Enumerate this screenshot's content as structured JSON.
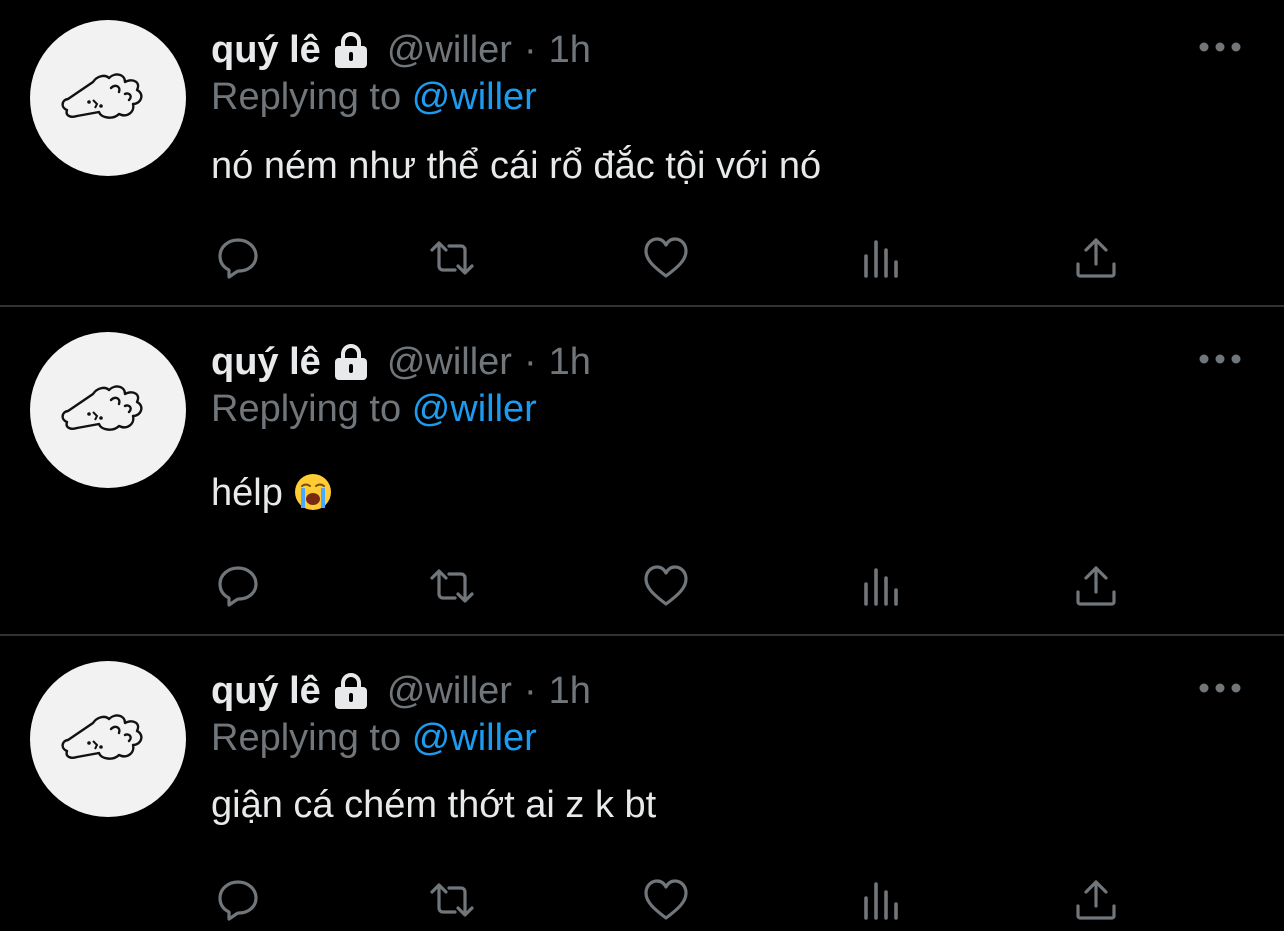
{
  "tweets": [
    {
      "author": {
        "name": "quý lê",
        "handle": "@willer",
        "protected_icon": "lock-icon",
        "avatar_icon": "bear-doodle-avatar"
      },
      "time": "1h",
      "separator": "·",
      "replying_label": "Replying to",
      "replying_to": "@willer",
      "text": "nó ném như thể cái rổ đắc tội với nó",
      "emoji": null
    },
    {
      "author": {
        "name": "quý lê",
        "handle": "@willer",
        "protected_icon": "lock-icon",
        "avatar_icon": "bear-doodle-avatar"
      },
      "time": "1h",
      "separator": "·",
      "replying_label": "Replying to",
      "replying_to": "@willer",
      "text": "hélp",
      "emoji": "loudly-crying-face"
    },
    {
      "author": {
        "name": "quý lê",
        "handle": "@willer",
        "protected_icon": "lock-icon",
        "avatar_icon": "bear-doodle-avatar"
      },
      "time": "1h",
      "separator": "·",
      "replying_label": "Replying to",
      "replying_to": "@willer",
      "text": "giận cá chém thớt ai z k bt",
      "emoji": null
    }
  ],
  "action_icons": [
    "reply-icon",
    "retweet-icon",
    "like-icon",
    "views-icon",
    "share-icon"
  ],
  "colors": {
    "background": "#000000",
    "text": "#e7e9ea",
    "muted": "#71767b",
    "accent": "#1d9bf0",
    "divider": "#2f3336"
  }
}
